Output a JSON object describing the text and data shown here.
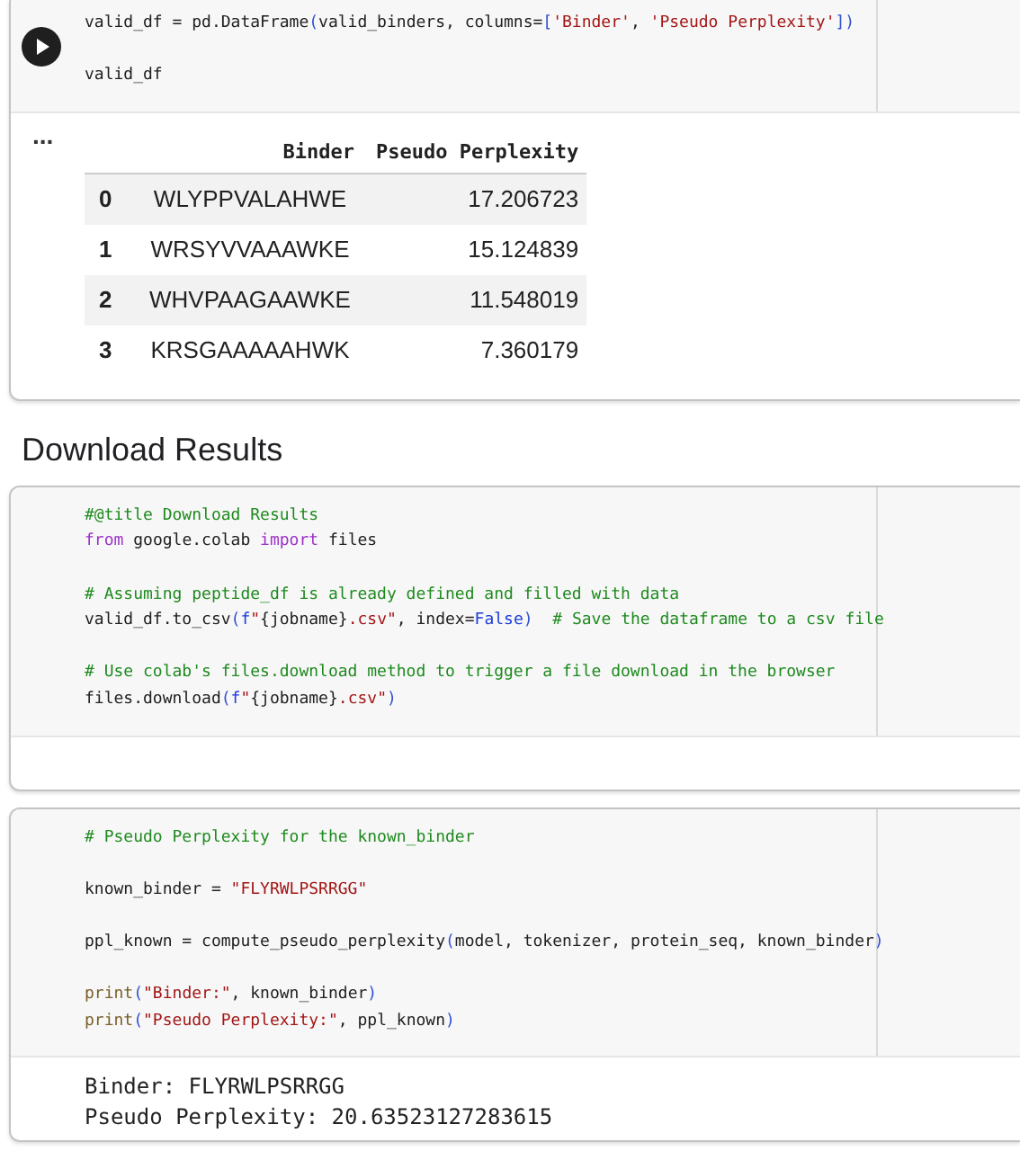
{
  "blocks": [
    {
      "kind": "code_cell",
      "show_run_button": true,
      "lines": [
        {
          "gap_before": false,
          "tokens": [
            {
              "kind": "plain",
              "text": "valid_df = pd.DataFrame"
            },
            {
              "kind": "bracket",
              "text": "("
            },
            {
              "kind": "plain",
              "text": "valid_binders, columns="
            },
            {
              "kind": "bracket",
              "text": "["
            },
            {
              "kind": "string",
              "text": "'Binder'"
            },
            {
              "kind": "plain",
              "text": ", "
            },
            {
              "kind": "string",
              "text": "'Pseudo Perplexity'"
            },
            {
              "kind": "bracket",
              "text": "])"
            }
          ]
        },
        {
          "gap_before": true,
          "tokens": [
            {
              "kind": "plain",
              "text": "valid_df"
            }
          ]
        }
      ],
      "output": {
        "kind": "table",
        "marker": "...",
        "columns": [
          "Binder",
          "Pseudo Perplexity"
        ],
        "rows": [
          {
            "index": "0",
            "cells": [
              "WLYPPVALAHWE",
              "17.206723"
            ]
          },
          {
            "index": "1",
            "cells": [
              "WRSYVVAAAWKE",
              "15.124839"
            ]
          },
          {
            "index": "2",
            "cells": [
              "WHVPAAGAAWKE",
              "11.548019"
            ]
          },
          {
            "index": "3",
            "cells": [
              "KRSGAAAAAHWK",
              "7.360179"
            ]
          }
        ]
      }
    },
    {
      "kind": "heading",
      "text": "Download Results"
    },
    {
      "kind": "code_cell",
      "show_run_button": false,
      "lines": [
        {
          "gap_before": false,
          "tokens": [
            {
              "kind": "comment",
              "text": "#@title Download Results"
            }
          ]
        },
        {
          "gap_before": false,
          "tokens": [
            {
              "kind": "keyword",
              "text": "from"
            },
            {
              "kind": "plain",
              "text": " google.colab "
            },
            {
              "kind": "keyword",
              "text": "import"
            },
            {
              "kind": "plain",
              "text": " files"
            }
          ]
        },
        {
          "gap_before": true,
          "tokens": [
            {
              "kind": "comment",
              "text": "# Assuming peptide_df is already defined and filled with data"
            }
          ]
        },
        {
          "gap_before": false,
          "tokens": [
            {
              "kind": "plain",
              "text": "valid_df.to_csv"
            },
            {
              "kind": "bracket",
              "text": "("
            },
            {
              "kind": "constant",
              "text": "f"
            },
            {
              "kind": "string",
              "text": "\""
            },
            {
              "kind": "plain",
              "text": "{jobname}"
            },
            {
              "kind": "string",
              "text": ".csv\""
            },
            {
              "kind": "plain",
              "text": ", index="
            },
            {
              "kind": "constant",
              "text": "False"
            },
            {
              "kind": "bracket",
              "text": ")"
            },
            {
              "kind": "comment",
              "text": "  # Save the dataframe to a csv file"
            }
          ]
        },
        {
          "gap_before": true,
          "tokens": [
            {
              "kind": "comment",
              "text": "# Use colab's files.download method to trigger a file download in the browser"
            }
          ]
        },
        {
          "gap_before": false,
          "tokens": [
            {
              "kind": "plain",
              "text": "files.download"
            },
            {
              "kind": "bracket",
              "text": "("
            },
            {
              "kind": "constant",
              "text": "f"
            },
            {
              "kind": "string",
              "text": "\""
            },
            {
              "kind": "plain",
              "text": "{jobname}"
            },
            {
              "kind": "string",
              "text": ".csv\""
            },
            {
              "kind": "bracket",
              "text": ")"
            }
          ]
        }
      ],
      "output": {
        "kind": "empty"
      }
    },
    {
      "kind": "code_cell",
      "show_run_button": false,
      "lines": [
        {
          "gap_before": false,
          "tokens": [
            {
              "kind": "comment",
              "text": "# Pseudo Perplexity for the known_binder"
            }
          ]
        },
        {
          "gap_before": true,
          "tokens": [
            {
              "kind": "plain",
              "text": "known_binder = "
            },
            {
              "kind": "string",
              "text": "\"FLYRWLPSRRGG\""
            }
          ]
        },
        {
          "gap_before": true,
          "tokens": [
            {
              "kind": "plain",
              "text": "ppl_known = compute_pseudo_perplexity"
            },
            {
              "kind": "bracket",
              "text": "("
            },
            {
              "kind": "plain",
              "text": "model, tokenizer, protein_seq, known_binder"
            },
            {
              "kind": "bracket",
              "text": ")"
            }
          ]
        },
        {
          "gap_before": true,
          "tokens": [
            {
              "kind": "builtin",
              "text": "print"
            },
            {
              "kind": "bracket",
              "text": "("
            },
            {
              "kind": "string",
              "text": "\"Binder:\""
            },
            {
              "kind": "plain",
              "text": ", known_binder"
            },
            {
              "kind": "bracket",
              "text": ")"
            }
          ]
        },
        {
          "gap_before": false,
          "tokens": [
            {
              "kind": "builtin",
              "text": "print"
            },
            {
              "kind": "bracket",
              "text": "("
            },
            {
              "kind": "string",
              "text": "\"Pseudo Perplexity:\""
            },
            {
              "kind": "plain",
              "text": ", ppl_known"
            },
            {
              "kind": "bracket",
              "text": ")"
            }
          ]
        }
      ],
      "output": {
        "kind": "text",
        "lines": [
          "Binder: FLYRWLPSRRGG",
          "Pseudo Perplexity: 20.63523127283615"
        ]
      }
    }
  ]
}
